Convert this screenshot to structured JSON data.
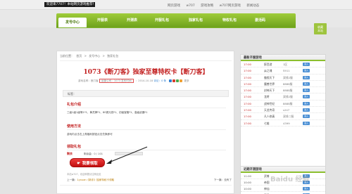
{
  "topbar": {
    "notice": "欢迎来7707！本站网页游戏推荐！",
    "links": [
      "网页游戏",
      "w707",
      "游戏攻略",
      "w707网页游戏",
      "新闻动态"
    ]
  },
  "nav": {
    "items": [
      "发号中心",
      "开服表",
      "开测表",
      "开服礼包",
      "独家礼包",
      "特权礼包",
      "激活码"
    ]
  },
  "fav_box": {
    "line1": "收藏",
    "line2": "本站"
  },
  "breadcrumb": [
    "当前位置：",
    "首页",
    ">",
    "发号中心",
    ">",
    "独家礼包"
  ],
  "article": {
    "title": "1073《断刀客》独家至尊特权卡【断刀客】",
    "meta_prefix": "游戏名称：断刀客",
    "meta_framed": "运营公司：1073 发布时间",
    "meta_date": "：2014-10-18",
    "meta_views": "评论：0 条",
    "meta_more": "更多"
  },
  "tag_bar": {
    "label": "标签："
  },
  "sections": {
    "gift_content_title": "礼包介绍",
    "gift_content_text": "三级1级1级等1*1、黄灵牌*1、80铜元钱*1、初级宝箱*1、高级武器*1",
    "usage_title": "使用方法",
    "usage_text": "游戏内点击右上角福利按钮点击兑换即可",
    "claim_title": "领取礼包"
  },
  "claim": {
    "label": "剩余",
    "remaining": "剩余量：0 / 101",
    "remaining_pct": 0,
    "button_text": "我要领取"
  },
  "footnote": "本站w707，欢迎转载请注明出处",
  "prevnext": {
    "prev_label": "上一篇：",
    "prev_text": "1yxuan《新手》独家特权卡领取",
    "next_label": "下一篇：",
    "next_text": "没有了"
  },
  "side1": {
    "title": "最新开服游戏",
    "button_label": "进入",
    "rows": [
      {
        "time": "17:00",
        "game": "醉西游",
        "server": "1区"
      },
      {
        "time": "17:00",
        "game": "焱之魂",
        "server": "S911"
      },
      {
        "time": "17:00",
        "game": "傲视天下",
        "server": "双线2服"
      },
      {
        "time": "17:00",
        "game": "魔兽世界",
        "server": "8888服"
      },
      {
        "time": "17:00",
        "game": "封神天下",
        "server": "8888服"
      },
      {
        "time": "17:00",
        "game": "龙将",
        "server": "双线2服"
      },
      {
        "time": "17:00",
        "game": "战神世纪",
        "server": "8888服"
      },
      {
        "time": "17:00",
        "game": "天龙传奇",
        "server": "s247"
      },
      {
        "time": "17:00",
        "game": "凡人修真",
        "server": "双线二服"
      },
      {
        "time": "17:00",
        "game": "七雄",
        "server": "4399"
      }
    ]
  },
  "side2": {
    "title": "近期开测游戏",
    "button_label": "进入",
    "rows": [
      {
        "time": "11:00",
        "game": "武尊"
      },
      {
        "time": "10:00",
        "game": "帝国"
      },
      {
        "time": "10:00",
        "game": "神仙"
      },
      {
        "time": "10:00",
        "game": "天元"
      }
    ]
  },
  "watermark": "Baidu 经验"
}
